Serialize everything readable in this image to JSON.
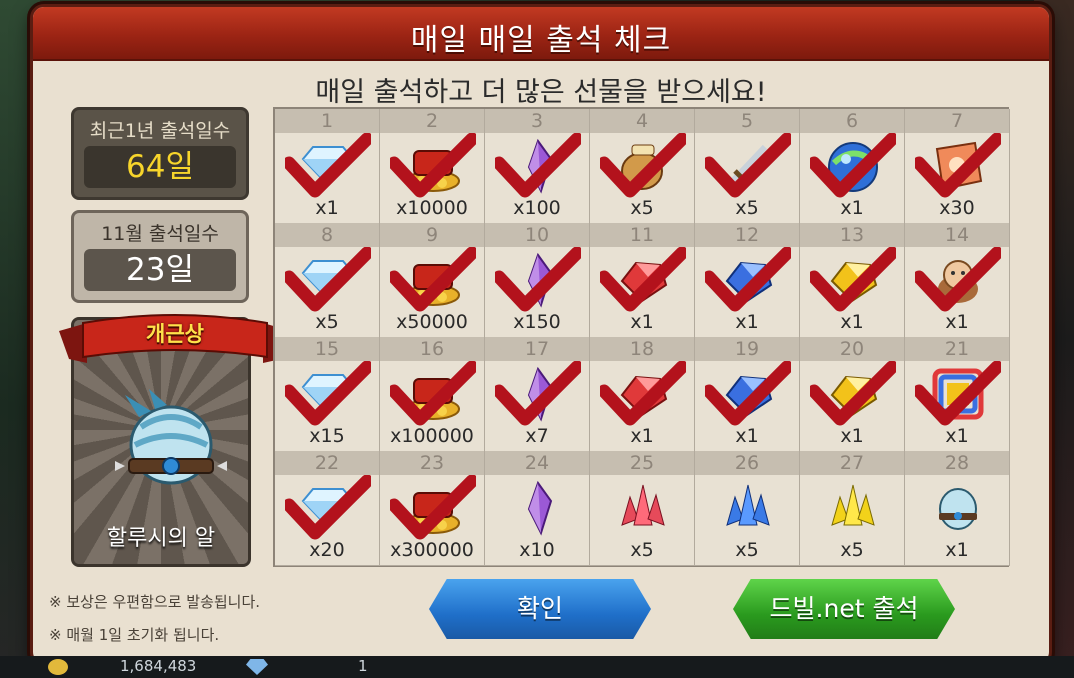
{
  "window": {
    "title": "매일 매일 출석 체크",
    "subtitle": "매일 출석하고 더 많은 선물을 받으세요!"
  },
  "stats": {
    "yearly_label": "최근1년 출석일수",
    "yearly_value": "64일",
    "monthly_label": "11월 출석일수",
    "monthly_value": "23일"
  },
  "award": {
    "ribbon": "개근상",
    "name": "할루시의 알",
    "icon": "egg-icon"
  },
  "days": [
    {
      "day": "1",
      "qty": "x1",
      "icon": "diamond-icon",
      "checked": true
    },
    {
      "day": "2",
      "qty": "x10000",
      "icon": "gold-chest-icon",
      "checked": true
    },
    {
      "day": "3",
      "qty": "x100",
      "icon": "purple-crystal-icon",
      "checked": true
    },
    {
      "day": "4",
      "qty": "x5",
      "icon": "scroll-bag-icon",
      "checked": true
    },
    {
      "day": "5",
      "qty": "x5",
      "icon": "sword-icon",
      "checked": true
    },
    {
      "day": "6",
      "qty": "x1",
      "icon": "orb-icon",
      "checked": true
    },
    {
      "day": "7",
      "qty": "x30",
      "icon": "ticket-icon",
      "checked": true
    },
    {
      "day": "8",
      "qty": "x5",
      "icon": "diamond-icon",
      "checked": true
    },
    {
      "day": "9",
      "qty": "x50000",
      "icon": "gold-chest-icon",
      "checked": true
    },
    {
      "day": "10",
      "qty": "x150",
      "icon": "purple-crystal-icon",
      "checked": true
    },
    {
      "day": "11",
      "qty": "x1",
      "icon": "red-gem-icon",
      "checked": true
    },
    {
      "day": "12",
      "qty": "x1",
      "icon": "blue-gem-icon",
      "checked": true
    },
    {
      "day": "13",
      "qty": "x1",
      "icon": "yellow-gem-icon",
      "checked": true
    },
    {
      "day": "14",
      "qty": "x1",
      "icon": "pet-icon",
      "checked": true
    },
    {
      "day": "15",
      "qty": "x15",
      "icon": "diamond-icon",
      "checked": true
    },
    {
      "day": "16",
      "qty": "x100000",
      "icon": "gold-chest-icon",
      "checked": true
    },
    {
      "day": "17",
      "qty": "x7",
      "icon": "purple-crystal-icon",
      "checked": true
    },
    {
      "day": "18",
      "qty": "x1",
      "icon": "red-gem-icon",
      "checked": true
    },
    {
      "day": "19",
      "qty": "x1",
      "icon": "blue-gem-icon",
      "checked": true
    },
    {
      "day": "20",
      "qty": "x1",
      "icon": "yellow-gem-icon",
      "checked": true
    },
    {
      "day": "21",
      "qty": "x1",
      "icon": "rainbow-frame-icon",
      "checked": true
    },
    {
      "day": "22",
      "qty": "x20",
      "icon": "diamond-icon",
      "checked": true
    },
    {
      "day": "23",
      "qty": "x300000",
      "icon": "gold-chest-icon",
      "checked": true
    },
    {
      "day": "24",
      "qty": "x10",
      "icon": "purple-crystal-icon",
      "checked": false
    },
    {
      "day": "25",
      "qty": "x5",
      "icon": "red-crystal-cluster-icon",
      "checked": false
    },
    {
      "day": "26",
      "qty": "x5",
      "icon": "blue-crystal-cluster-icon",
      "checked": false
    },
    {
      "day": "27",
      "qty": "x5",
      "icon": "yellow-crystal-cluster-icon",
      "checked": false
    },
    {
      "day": "28",
      "qty": "x1",
      "icon": "egg-icon",
      "checked": false
    }
  ],
  "notes": [
    "※ 보상은 우편함으로 발송됩니다.",
    "※ 매월 1일 초기화 됩니다."
  ],
  "buttons": {
    "confirm": "확인",
    "dbeel": "드빌.net 출석"
  },
  "bottom_bar": {
    "gold": "1,684,483",
    "gems": "1"
  },
  "colors": {
    "title_bar": "#9c2414",
    "check": "#b3121c",
    "confirm_button": "#1f6fc9",
    "dbeel_button": "#2a9a1e",
    "yearly_value": "#f7d52b"
  }
}
